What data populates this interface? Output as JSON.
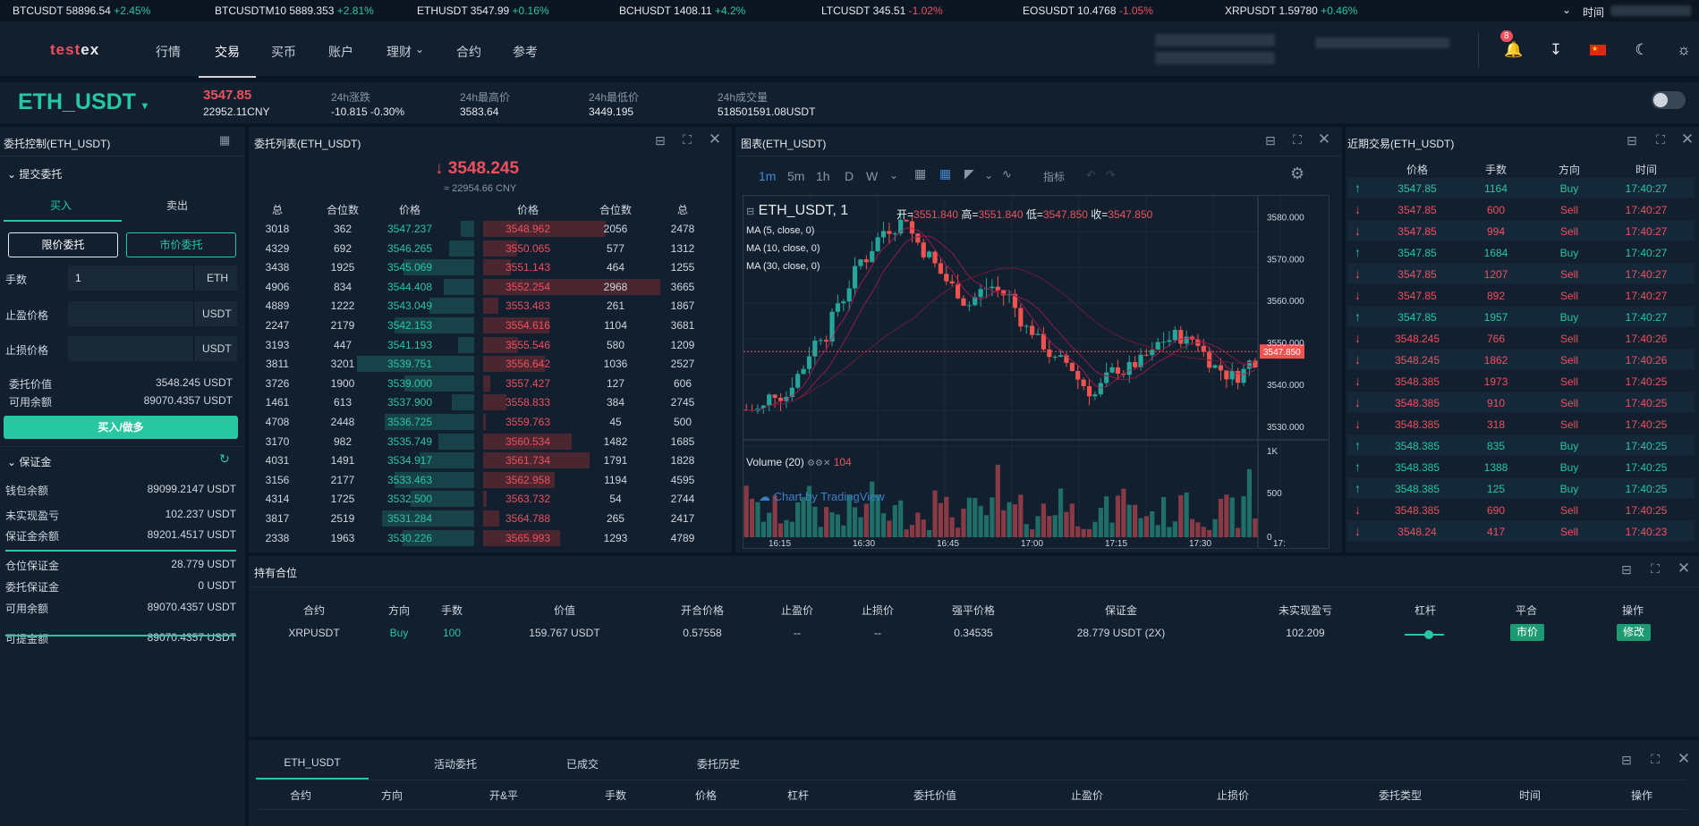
{
  "ticker": [
    {
      "sym": "BTCUSDT",
      "price": "58896.54",
      "chg": "+2.45%",
      "up": true
    },
    {
      "sym": "BTCUSDTM10",
      "price": "5889.353",
      "chg": "+2.81%",
      "up": true
    },
    {
      "sym": "ETHUSDT",
      "price": "3547.99",
      "chg": "+0.16%",
      "up": true
    },
    {
      "sym": "BCHUSDT",
      "price": "1408.11",
      "chg": "+4.2%",
      "up": true
    },
    {
      "sym": "LTCUSDT",
      "price": "345.51",
      "chg": "-1.02%",
      "up": false
    },
    {
      "sym": "EOSUSDT",
      "price": "10.4768",
      "chg": "-1.05%",
      "up": false
    },
    {
      "sym": "XRPUSDT",
      "price": "1.59780",
      "chg": "+0.46%",
      "up": true
    }
  ],
  "ticker_more": "时间",
  "header": {
    "logo_a": "test",
    "logo_b": "ex",
    "nav": [
      "行情",
      "交易",
      "买币",
      "账户",
      "理财",
      "合约",
      "参考"
    ],
    "notif_count": "8"
  },
  "market": {
    "pair": "ETH_USDT",
    "last": "3547.85",
    "last_cny": "22952.11CNY",
    "stats": [
      {
        "label": "24h涨跌",
        "value": "-10.815 -0.30%"
      },
      {
        "label": "24h最高价",
        "value": "3583.64"
      },
      {
        "label": "24h最低价",
        "value": "3449.195"
      },
      {
        "label": "24h成交量",
        "value": "518501591.08USDT"
      }
    ]
  },
  "order_panel": {
    "title": "委托控制(ETH_USDT)",
    "section": "提交委托",
    "tab_buy": "买入",
    "tab_sell": "卖出",
    "limit": "限价委托",
    "market": "市价委托",
    "qty_label": "手数",
    "qty_value": "1",
    "qty_unit": "ETH",
    "tp_label": "止盈价格",
    "tp_unit": "USDT",
    "sl_label": "止损价格",
    "sl_unit": "USDT",
    "order_value_label": "委托价值",
    "order_value": "3548.245 USDT",
    "avail_label": "可用余额",
    "avail": "89070.4357 USDT",
    "submit": "买入/做多"
  },
  "margin": {
    "title": "保证金",
    "rows": [
      {
        "label": "钱包余额",
        "value": "89099.2147 USDT"
      },
      {
        "label": "未实现盈亏",
        "value": "102.237 USDT"
      },
      {
        "label": "保证金余额",
        "value": "89201.4517 USDT"
      },
      {
        "label": "仓位保证金",
        "value": "28.779 USDT"
      },
      {
        "label": "委托保证金",
        "value": "0 USDT"
      },
      {
        "label": "可用余额",
        "value": "89070.4357 USDT"
      },
      {
        "label": "可提金额",
        "value": "89070.4357 USDT"
      }
    ]
  },
  "orderbook": {
    "title": "委托列表(ETH_USDT)",
    "mid": "3548.245",
    "mid_cny": "≈ 22954.66 CNY",
    "headers": [
      "总",
      "合位数",
      "价格",
      "价格",
      "合位数",
      "总"
    ],
    "rows": [
      [
        "3018",
        "362",
        "3547.237",
        "3548.962",
        "2056",
        "2478"
      ],
      [
        "4329",
        "692",
        "3546.265",
        "3550.065",
        "577",
        "1312"
      ],
      [
        "3438",
        "1925",
        "3545.069",
        "3551.143",
        "464",
        "1255"
      ],
      [
        "4906",
        "834",
        "3544.408",
        "3552.254",
        "2968",
        "3665"
      ],
      [
        "4889",
        "1222",
        "3543.049",
        "3553.483",
        "261",
        "1867"
      ],
      [
        "2247",
        "2179",
        "3542.153",
        "3554.616",
        "1104",
        "3681"
      ],
      [
        "3193",
        "447",
        "3541.193",
        "3555.546",
        "580",
        "1209"
      ],
      [
        "3811",
        "3201",
        "3539.751",
        "3556.642",
        "1036",
        "2527"
      ],
      [
        "3726",
        "1900",
        "3539.000",
        "3557.427",
        "127",
        "606"
      ],
      [
        "1461",
        "613",
        "3537.900",
        "3558.833",
        "384",
        "2745"
      ],
      [
        "4708",
        "2448",
        "3536.725",
        "3559.763",
        "45",
        "500"
      ],
      [
        "3170",
        "982",
        "3535.749",
        "3560.534",
        "1482",
        "1685"
      ],
      [
        "4031",
        "1491",
        "3534.917",
        "3561.734",
        "1791",
        "1828"
      ],
      [
        "3156",
        "2177",
        "3533.463",
        "3562.958",
        "1194",
        "4595"
      ],
      [
        "4314",
        "1725",
        "3532.500",
        "3563.732",
        "54",
        "2744"
      ],
      [
        "3817",
        "2519",
        "3531.284",
        "3564.788",
        "265",
        "2417"
      ],
      [
        "2338",
        "1963",
        "3530.226",
        "3565.993",
        "1293",
        "4789"
      ]
    ]
  },
  "chart": {
    "title": "图表(ETH_USDT)",
    "intervals": [
      "1m",
      "5m",
      "1h",
      "D",
      "W"
    ],
    "indicator_label": "指标",
    "legend_symbol": "ETH_USDT, 1",
    "o_label": "开=",
    "o": "3551.840",
    "h_label": "高=",
    "h": "3551.840",
    "l_label": "低=",
    "l": "3547.850",
    "c_label": "收=",
    "c": "3547.850",
    "ma": [
      "MA (5, close, 0)",
      "MA (10, close, 0)",
      "MA (30, close, 0)"
    ],
    "volume_label": "Volume (20)",
    "volume_value": "104",
    "price_ticks": [
      "3580.000",
      "3570.000",
      "3560.000",
      "3550.000",
      "3540.000",
      "3530.000"
    ],
    "last_tag": "3547.850",
    "vol_ticks": [
      "1K",
      "500",
      "0"
    ],
    "time_ticks": [
      "16:15",
      "16:30",
      "16:45",
      "17:00",
      "17:15",
      "17:30",
      "17:"
    ],
    "watermark": "Chart by TradingView"
  },
  "chart_data": {
    "type": "candlestick",
    "series": [
      {
        "name": "ETH_USDT, 1",
        "last_close": 3547.85
      },
      {
        "name": "Volume (20)",
        "last": 104
      }
    ],
    "ylim": [
      3527,
      3585
    ],
    "xlabel": "",
    "ylabel": ""
  },
  "trades": {
    "title": "近期交易(ETH_USDT)",
    "headers": [
      "价格",
      "手数",
      "方向",
      "时间"
    ],
    "rows": [
      {
        "p": "3547.85",
        "q": "1164",
        "d": "Buy",
        "t": "17:40:27",
        "up": true
      },
      {
        "p": "3547.85",
        "q": "600",
        "d": "Sell",
        "t": "17:40:27",
        "up": false
      },
      {
        "p": "3547.85",
        "q": "994",
        "d": "Sell",
        "t": "17:40:27",
        "up": false
      },
      {
        "p": "3547.85",
        "q": "1684",
        "d": "Buy",
        "t": "17:40:27",
        "up": true
      },
      {
        "p": "3547.85",
        "q": "1207",
        "d": "Sell",
        "t": "17:40:27",
        "up": false
      },
      {
        "p": "3547.85",
        "q": "892",
        "d": "Sell",
        "t": "17:40:27",
        "up": false
      },
      {
        "p": "3547.85",
        "q": "1957",
        "d": "Buy",
        "t": "17:40:27",
        "up": true
      },
      {
        "p": "3548.245",
        "q": "766",
        "d": "Sell",
        "t": "17:40:26",
        "up": false
      },
      {
        "p": "3548.245",
        "q": "1862",
        "d": "Sell",
        "t": "17:40:26",
        "up": false
      },
      {
        "p": "3548.385",
        "q": "1973",
        "d": "Sell",
        "t": "17:40:25",
        "up": false
      },
      {
        "p": "3548.385",
        "q": "910",
        "d": "Sell",
        "t": "17:40:25",
        "up": false
      },
      {
        "p": "3548.385",
        "q": "318",
        "d": "Sell",
        "t": "17:40:25",
        "up": false
      },
      {
        "p": "3548.385",
        "q": "835",
        "d": "Buy",
        "t": "17:40:25",
        "up": true
      },
      {
        "p": "3548.385",
        "q": "1388",
        "d": "Buy",
        "t": "17:40:25",
        "up": true
      },
      {
        "p": "3548.385",
        "q": "125",
        "d": "Buy",
        "t": "17:40:25",
        "up": true
      },
      {
        "p": "3548.385",
        "q": "690",
        "d": "Sell",
        "t": "17:40:25",
        "up": false
      },
      {
        "p": "3548.24",
        "q": "417",
        "d": "Sell",
        "t": "17:40:23",
        "up": false
      }
    ]
  },
  "positions": {
    "title": "持有合位",
    "headers": [
      "合约",
      "方向",
      "手数",
      "价值",
      "开合价格",
      "止盈价",
      "止损价",
      "强平价格",
      "保证金",
      "未实现盈亏",
      "杠杆",
      "平合",
      "操作"
    ],
    "row": {
      "symbol": "XRPUSDT",
      "dir": "Buy",
      "qty": "100",
      "value": "159.767 USDT",
      "open": "0.57558",
      "tp": "--",
      "sl": "--",
      "liq": "0.34535",
      "margin": "28.779 USDT (2X)",
      "pnl": "102.209",
      "close_btn": "市价",
      "edit_btn": "修改"
    }
  },
  "bottom": {
    "tabs": [
      "ETH_USDT",
      "活动委托",
      "已成交",
      "委托历史"
    ],
    "headers": [
      "合约",
      "方向",
      "开&平",
      "手数",
      "价格",
      "杠杆",
      "委托价值",
      "止盈价",
      "止损价",
      "委托类型",
      "时间",
      "操作"
    ]
  }
}
